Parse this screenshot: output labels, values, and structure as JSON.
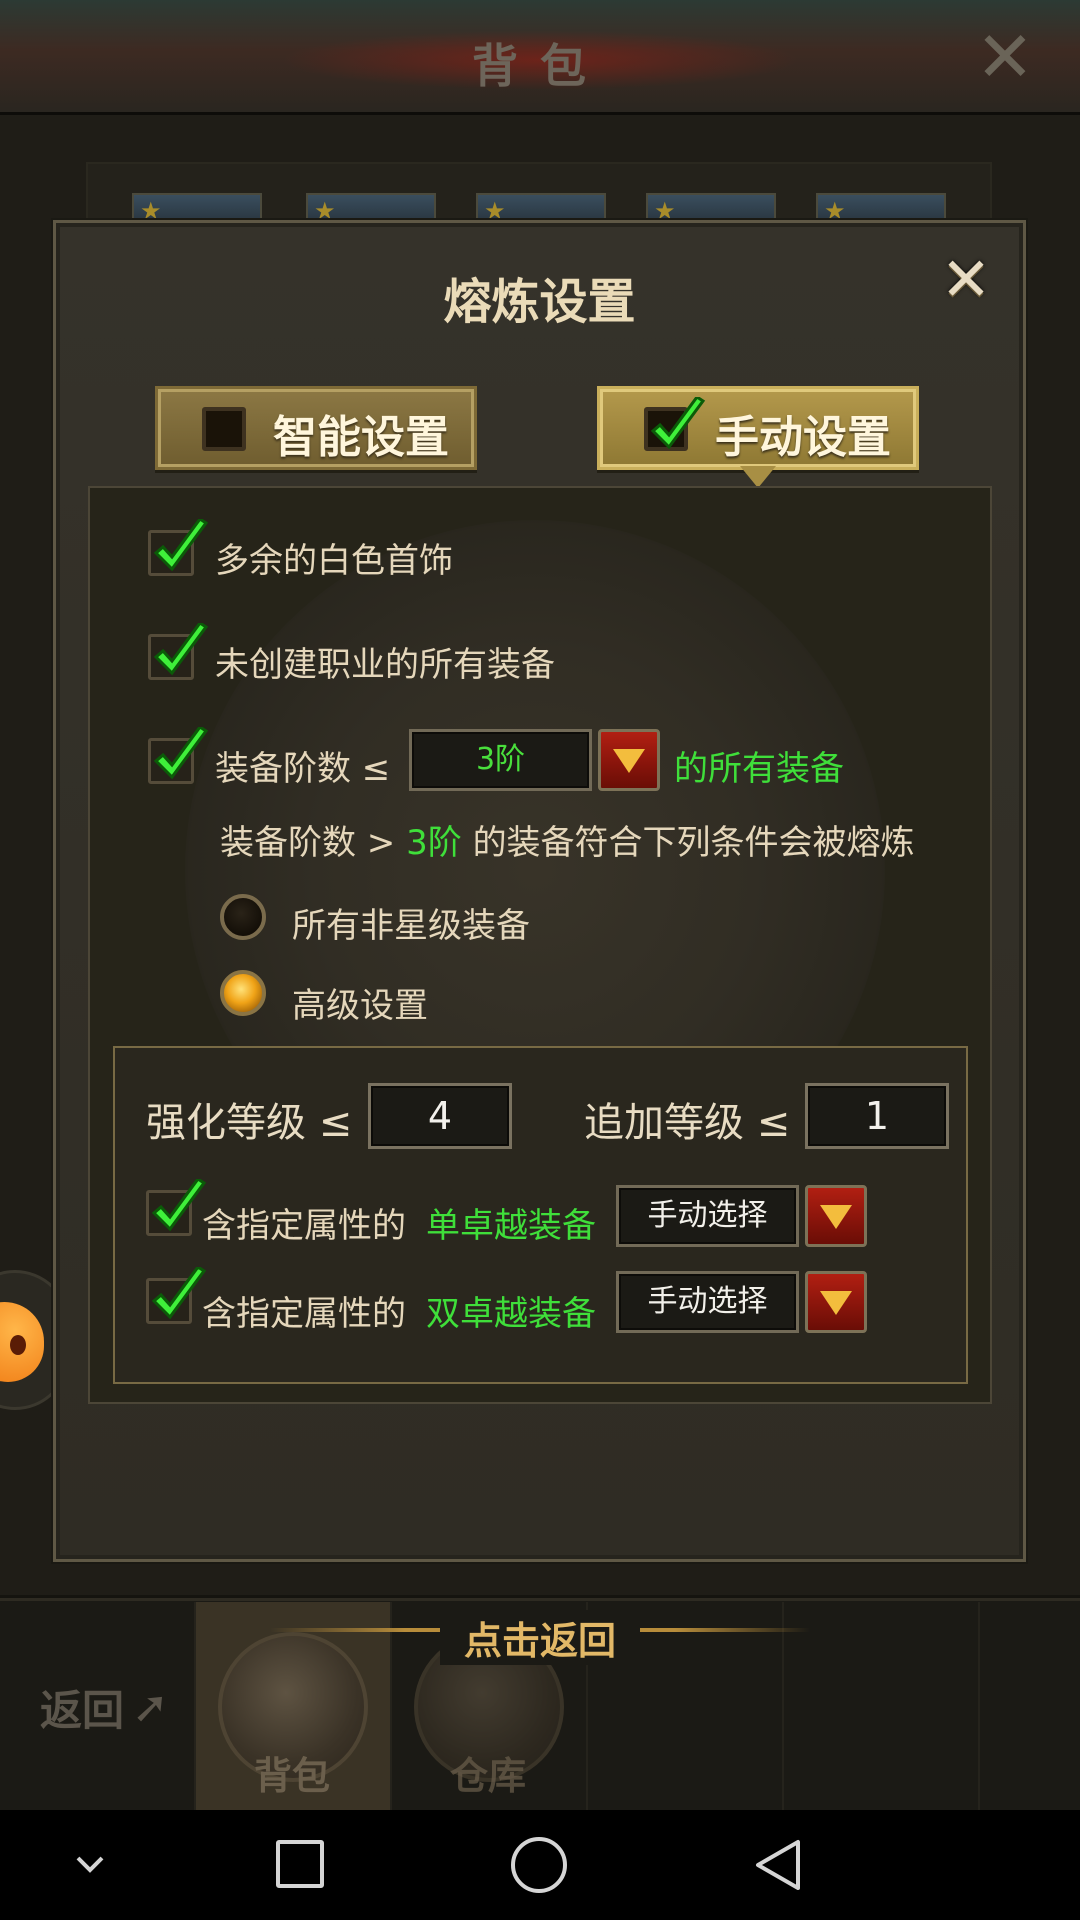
{
  "background": {
    "title": "背包",
    "bottom": {
      "back_label": "返回",
      "tap_return": "点击返回",
      "tabs": [
        {
          "label": "背包",
          "active": true
        },
        {
          "label": "仓库",
          "active": false
        }
      ]
    }
  },
  "dialog": {
    "title": "熔炼设置",
    "tabs": [
      {
        "label": "智能设置",
        "checked": false
      },
      {
        "label": "手动设置",
        "checked": true
      }
    ],
    "options": {
      "white_jewelry": {
        "label": "多余的白色首饰",
        "checked": true
      },
      "uncreated_class": {
        "label": "未创建职业的所有装备",
        "checked": true
      },
      "tier_rule": {
        "checked": true,
        "prefix": "装备阶数 ≤",
        "value": "3阶",
        "suffix": "的所有装备"
      }
    },
    "condition_line": {
      "prefix": "装备阶数 >",
      "value": "3阶",
      "suffix": "的装备符合下列条件会被熔炼"
    },
    "radios": [
      {
        "label": "所有非星级装备",
        "selected": false
      },
      {
        "label": "高级设置",
        "selected": true
      }
    ],
    "advanced": {
      "enhance_label": "强化等级 ≤",
      "enhance_value": "4",
      "append_label": "追加等级 ≤",
      "append_value": "1",
      "rows": [
        {
          "checked": true,
          "prefix": "含指定属性的",
          "highlight": "单卓越装备",
          "select": "手动选择"
        },
        {
          "checked": true,
          "prefix": "含指定属性的",
          "highlight": "双卓越装备",
          "select": "手动选择"
        }
      ]
    }
  },
  "colors": {
    "accent_green": "#3fdf3a",
    "gold": "#b4994c",
    "dropdown_red": "#b11f12",
    "radio_selected": "#f0a317"
  },
  "icons": [
    "close-icon",
    "checkbox-icon",
    "check-mark-icon",
    "dropdown-arrow-icon",
    "radio-icon",
    "back-arrow-icon",
    "nav-chevron-icon",
    "nav-home-icon",
    "nav-back-icon",
    "nav-recents-icon"
  ]
}
